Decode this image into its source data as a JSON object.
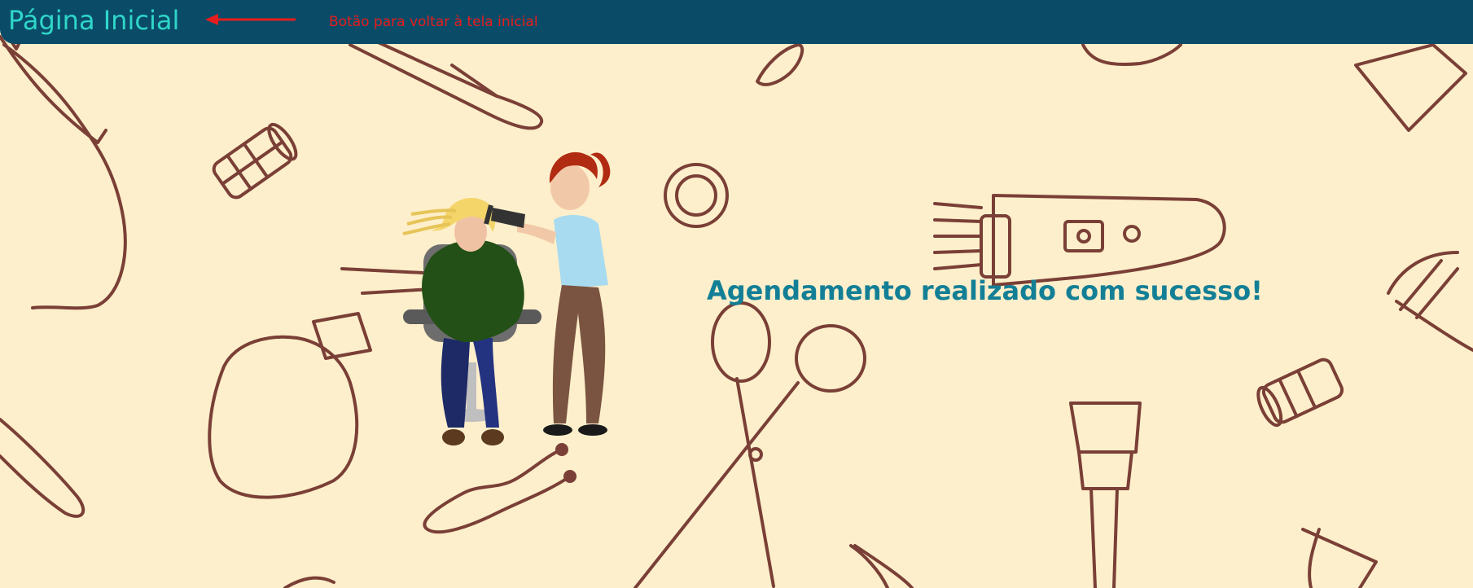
{
  "header": {
    "home_label": "Página Inicial",
    "annotation": "Botão para voltar à tela inicial"
  },
  "main": {
    "success_message": "Agendamento realizado com sucesso!"
  },
  "colors": {
    "header_bg": "#0a4c68",
    "home_label": "#2fd6c8",
    "annotation": "#e61d1d",
    "success_text": "#137f96",
    "page_bg": "#fdefcb",
    "pattern_line": "#7a3f36"
  },
  "icons": [
    "arrow-left-icon",
    "hairdresser-illustration",
    "salon-tools-pattern"
  ]
}
